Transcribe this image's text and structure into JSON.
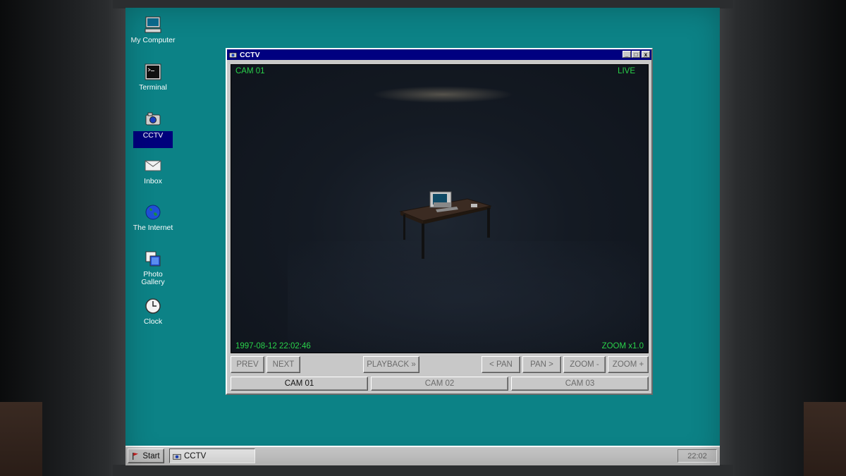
{
  "desktop": {
    "icons": [
      {
        "label": "My Computer",
        "icon": "computer-icon"
      },
      {
        "label": "Terminal",
        "icon": "terminal-icon"
      },
      {
        "label": "CCTV",
        "icon": "camera-icon",
        "selected": true
      },
      {
        "label": "Inbox",
        "icon": "envelope-icon"
      },
      {
        "label": "The Internet",
        "icon": "globe-icon"
      },
      {
        "label": "Photo Gallery",
        "icon": "photo-icon"
      },
      {
        "label": "Clock",
        "icon": "clock-icon"
      }
    ]
  },
  "window": {
    "title": "CCTV",
    "controls": {
      "minimize": "_",
      "maximize": "□",
      "close": "x"
    }
  },
  "feed": {
    "camera_name": "CAM 01",
    "status": "LIVE",
    "timestamp": "1997-08-12 22:02:46",
    "zoom": "ZOOM x1.0"
  },
  "controls": {
    "prev": "PREV",
    "next": "NEXT",
    "playback": "PLAYBACK »",
    "pan_left": "< PAN",
    "pan_right": "PAN >",
    "zoom_out": "ZOOM -",
    "zoom_in": "ZOOM +"
  },
  "cameras": [
    {
      "label": "CAM 01",
      "active": true
    },
    {
      "label": "CAM 02",
      "active": false
    },
    {
      "label": "CAM 03",
      "active": false
    }
  ],
  "taskbar": {
    "start_label": "Start",
    "task_label": "CCTV",
    "clock": "22:02"
  },
  "colors": {
    "desktop": "#0c8286",
    "titlebar": "#000080",
    "osd_text": "#29d24a",
    "selection": "#00007c"
  }
}
